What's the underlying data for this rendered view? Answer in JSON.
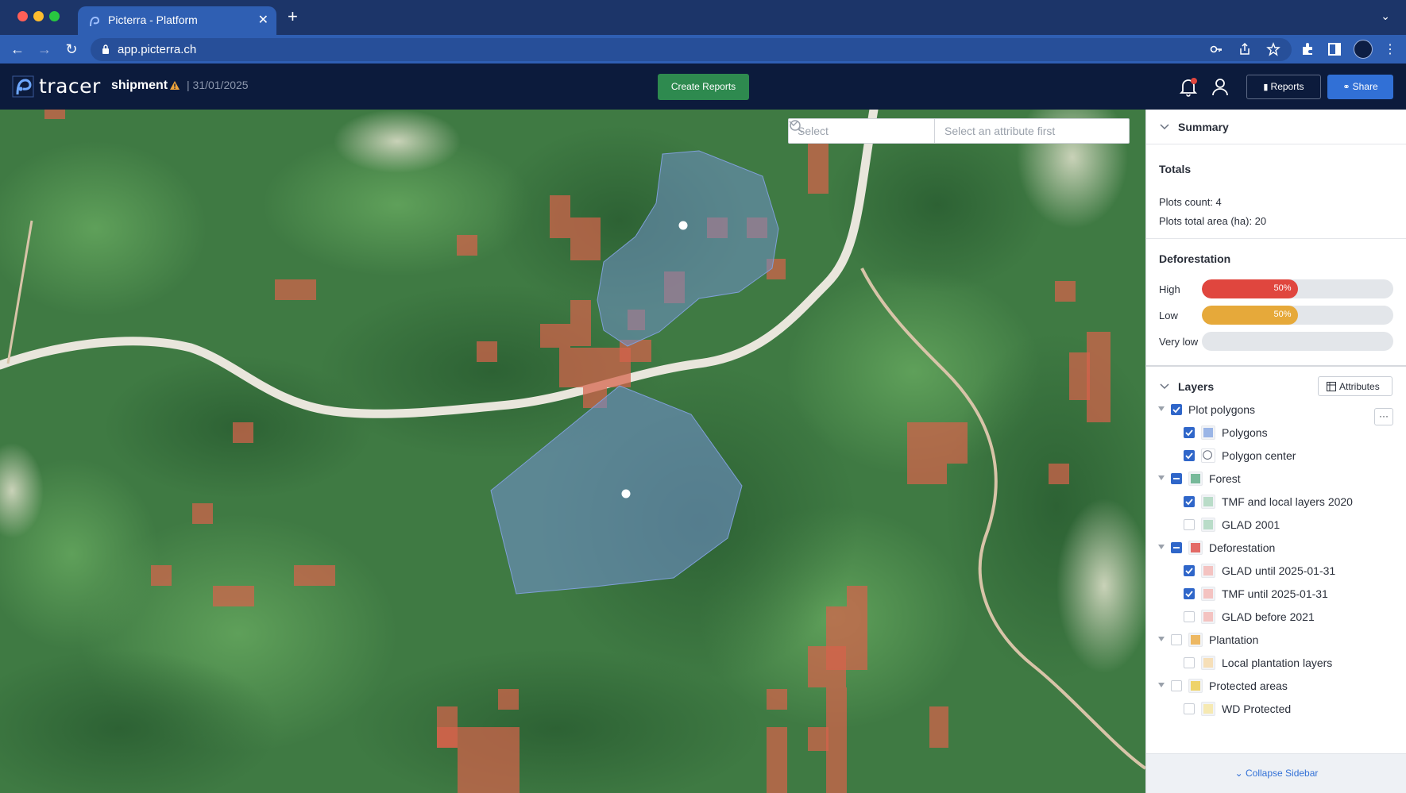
{
  "browser": {
    "tab_title": "Picterra - Platform",
    "url": "app.picterra.ch"
  },
  "header": {
    "logo_text": "tracer",
    "project_name": "shipment",
    "date": "| 31/01/2025",
    "create_reports_label": "Create Reports",
    "reports_label": "Reports",
    "share_label": "Share"
  },
  "map": {
    "select_placeholder": "Select",
    "attribute_placeholder": "Select an attribute first"
  },
  "sidebar": {
    "summary_title": "Summary",
    "totals_title": "Totals",
    "plots_count": "Plots count: 4",
    "plots_area": "Plots total area (ha): 20",
    "deforestation_title": "Deforestation",
    "deforestation_bars": [
      {
        "label": "High",
        "pct_label": "50%",
        "fraction": 0.5,
        "color": "#e0463e"
      },
      {
        "label": "Low",
        "pct_label": "50%",
        "fraction": 0.5,
        "color": "#e6a93a"
      },
      {
        "label": "Very low",
        "pct_label": "",
        "fraction": 0,
        "color": "#9aa1ab"
      }
    ],
    "layers_title": "Layers",
    "attributes_label": "Attributes",
    "more_label": "···",
    "layers": [
      {
        "name": "Plot polygons",
        "level": 0,
        "state": "on",
        "swatch": null
      },
      {
        "name": "Polygons",
        "level": 1,
        "state": "on",
        "swatch": "#9ab5e6"
      },
      {
        "name": "Polygon center",
        "level": 1,
        "state": "on",
        "swatch": "circle"
      },
      {
        "name": "Forest",
        "level": 0,
        "state": "partial",
        "swatch": "#77b99a"
      },
      {
        "name": "TMF and local layers 2020",
        "level": 1,
        "state": "on",
        "swatch": "#b9dcc8"
      },
      {
        "name": "GLAD 2001",
        "level": 1,
        "state": "off",
        "swatch": "#b9dcc8"
      },
      {
        "name": "Deforestation",
        "level": 0,
        "state": "partial",
        "swatch": "#e36a66"
      },
      {
        "name": "GLAD until 2025-01-31",
        "level": 1,
        "state": "on",
        "swatch": "#f4c3c1"
      },
      {
        "name": "TMF until 2025-01-31",
        "level": 1,
        "state": "on",
        "swatch": "#f4c3c1"
      },
      {
        "name": "GLAD before 2021",
        "level": 1,
        "state": "off",
        "swatch": "#f4c3c1"
      },
      {
        "name": "Plantation",
        "level": 0,
        "state": "off",
        "swatch": "#edb863"
      },
      {
        "name": "Local plantation layers",
        "level": 1,
        "state": "off",
        "swatch": "#f6dfb8"
      },
      {
        "name": "Protected areas",
        "level": 0,
        "state": "off",
        "swatch": "#eed36a"
      },
      {
        "name": "WD Protected",
        "level": 1,
        "state": "off",
        "swatch": "#f6e9b2"
      }
    ],
    "collapse_label": "Collapse Sidebar"
  }
}
